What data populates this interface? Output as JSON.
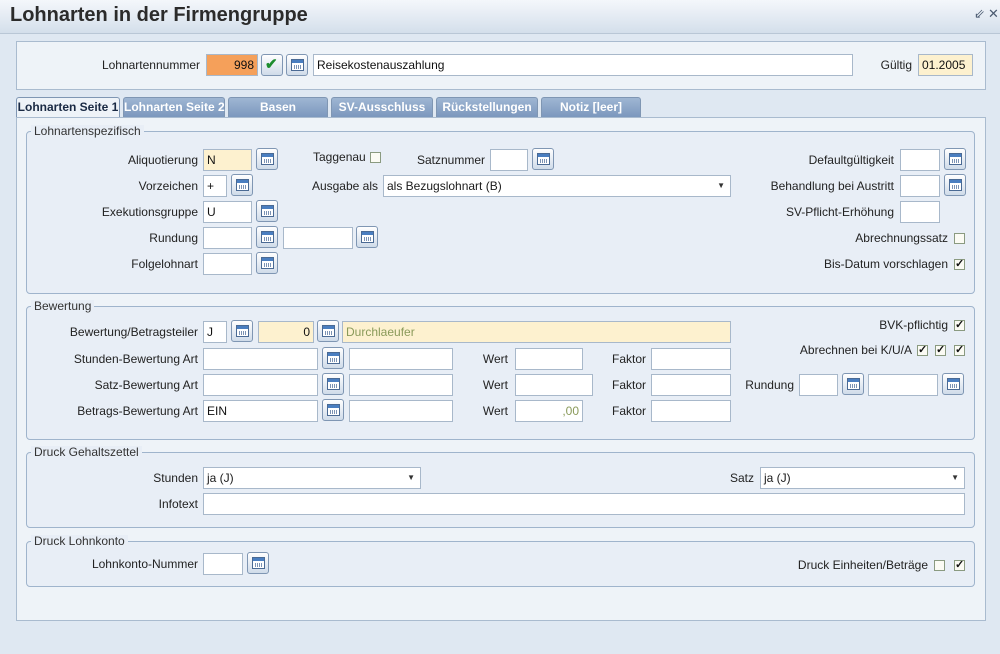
{
  "window": {
    "title": "Lohnarten in der Firmengruppe",
    "minimize_glyph": "⇙",
    "close_glyph": "✕"
  },
  "header": {
    "lohnartennummer_label": "Lohnartennummer",
    "lohnartennummer_value": "998",
    "description_value": "Reisekostenauszahlung",
    "gueltig_label": "Gültig",
    "gueltig_value": "01.2005"
  },
  "tabs": [
    {
      "label": "Lohnarten Seite 1",
      "active": true
    },
    {
      "label": "Lohnarten Seite 2",
      "active": false
    },
    {
      "label": "Basen",
      "active": false
    },
    {
      "label": "SV-Ausschluss",
      "active": false
    },
    {
      "label": "Rückstellungen",
      "active": false
    },
    {
      "label": "Notiz [leer]",
      "active": false
    }
  ],
  "spezifisch": {
    "legend": "Lohnartenspezifisch",
    "aliquotierung_label": "Aliquotierung",
    "aliquotierung_value": "N",
    "taggenau_label": "Taggenau",
    "satznummer_label": "Satznummer",
    "satznummer_value": "",
    "defaultgueltigkeit_label": "Defaultgültigkeit",
    "defaultgueltigkeit_value": "",
    "vorzeichen_label": "Vorzeichen",
    "vorzeichen_value": "+",
    "ausgabe_label": "Ausgabe als",
    "ausgabe_value": "als Bezugslohnart (B)",
    "behandlung_label": "Behandlung bei Austritt",
    "behandlung_value": "",
    "exekution_label": "Exekutionsgruppe",
    "exekution_value": "U",
    "svpflicht_label": "SV-Pflicht-Erhöhung",
    "svpflicht_value": "",
    "rundung_label": "Rundung",
    "rundung_value": "",
    "rundung_value2": "",
    "abrechnungssatz_label": "Abrechnungssatz",
    "folgelohnart_label": "Folgelohnart",
    "folgelohnart_value": "",
    "bisdatum_label": "Bis-Datum vorschlagen",
    "bisdatum_checked": "✓"
  },
  "bewertung": {
    "legend": "Bewertung",
    "betragsteiler_label": "Bewertung/Betragsteiler",
    "betragsteiler_value": "J",
    "betragsteiler_num": "0",
    "betragsteiler_text": "Durchlaeufer",
    "bvk_label": "BVK-pflichtig",
    "bvk_checked": "✓",
    "abrechnen_label": "Abrechnen bei K/U/A",
    "abrechnen_checks": [
      "✓",
      "✓",
      "✓"
    ],
    "stunden_label": "Stunden-Bewertung Art",
    "satz_label": "Satz-Bewertung Art",
    "betrags_label": "Betrags-Bewertung Art",
    "betrags_value": "EIN",
    "wert_label": "Wert",
    "faktor_label": "Faktor",
    "betrags_wert": ",00",
    "rundung_label": "Rundung"
  },
  "gehaltszettel": {
    "legend": "Druck Gehaltszettel",
    "stunden_label": "Stunden",
    "stunden_value": "ja (J)",
    "satz_label": "Satz",
    "satz_value": "ja (J)",
    "infotext_label": "Infotext",
    "infotext_value": ""
  },
  "lohnkonto": {
    "legend": "Druck Lohnkonto",
    "nummer_label": "Lohnkonto-Nummer",
    "nummer_value": "",
    "einheiten_label": "Druck Einheiten/Beträge",
    "einheiten_checks": [
      "",
      "✓"
    ]
  },
  "icons": {
    "picker": "calendar-list-icon",
    "confirm": "green-check-icon",
    "dropdown": "chevron-down-icon"
  }
}
